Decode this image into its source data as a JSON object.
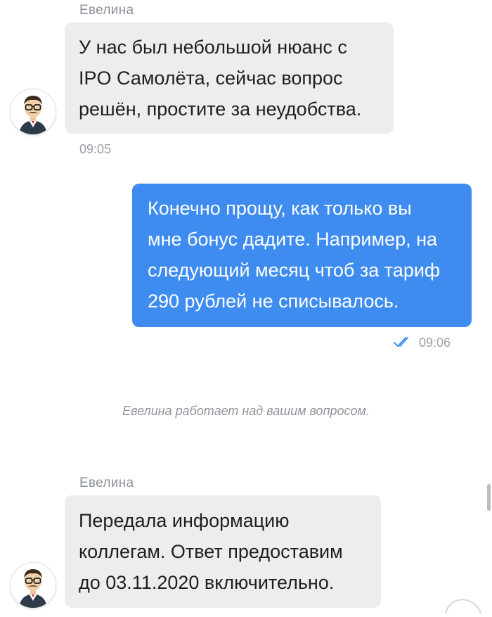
{
  "chat": {
    "messages": [
      {
        "direction": "incoming",
        "sender": "Евелина",
        "lines": [
          "У нас был небольшой нюанс с",
          "IPO Самолёта, сейчас вопрос",
          "решён, простите за неудобства."
        ],
        "time": "09:05"
      },
      {
        "direction": "outgoing",
        "lines": [
          "Конечно прощу, как только вы",
          "мне бонус дадите. Например, на",
          "следующий месяц чтоб за тариф",
          "290 рублей не списывалось."
        ],
        "time": "09:06",
        "read_status_icon": "double-check-icon"
      },
      {
        "direction": "incoming",
        "sender": "Евелина",
        "lines": [
          "Передала информацию",
          "коллегам. Ответ предоставим",
          "до 03.11.2020 включительно."
        ]
      }
    ],
    "status_text": "Евелина работает над вашим вопросом.",
    "avatar_icon": "agent-avatar-icon"
  },
  "colors": {
    "incoming_bubble": "#ecedef",
    "outgoing_bubble": "#3e8cf0",
    "meta_text": "#9aa0a6"
  }
}
